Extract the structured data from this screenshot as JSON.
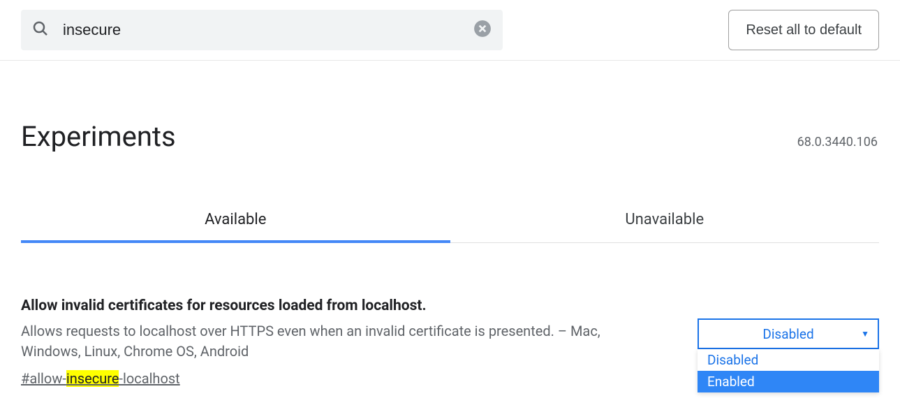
{
  "search": {
    "value": "insecure",
    "placeholder": ""
  },
  "buttons": {
    "reset": "Reset all to default"
  },
  "header": {
    "title": "Experiments",
    "version": "68.0.3440.106"
  },
  "tabs": {
    "available": "Available",
    "unavailable": "Unavailable"
  },
  "flag": {
    "title": "Allow invalid certificates for resources loaded from localhost.",
    "desc": "Allows requests to localhost over HTTPS even when an invalid certificate is presented. – Mac, Windows, Linux, Chrome OS, Android",
    "hash_prefix": "#allow-",
    "hash_highlight": "insecure",
    "hash_suffix": "-localhost",
    "select": {
      "selected": "Disabled",
      "options": [
        "Disabled",
        "Enabled"
      ]
    }
  }
}
